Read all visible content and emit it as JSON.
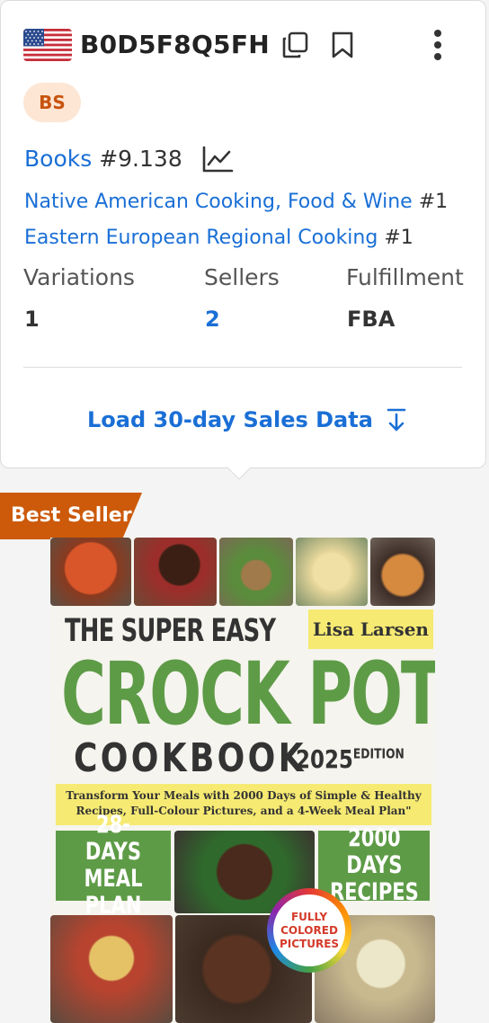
{
  "product": {
    "marketplace_flag": "us-flag-icon",
    "asin": "B0D5F8Q5FH",
    "badge": "BS",
    "category": "Books",
    "category_rank": "#9.138",
    "sub_ranks": [
      {
        "name": "Native American Cooking, Food & Wine",
        "rank": "#1"
      },
      {
        "name": "Eastern European Regional Cooking",
        "rank": "#1"
      }
    ],
    "stats": {
      "variations_label": "Variations",
      "variations_value": "1",
      "sellers_label": "Sellers",
      "sellers_value": "2",
      "fulfillment_label": "Fulfillment",
      "fulfillment_value": "FBA"
    },
    "load_button": "Load 30-day Sales Data"
  },
  "listing": {
    "ribbon": "Best Seller",
    "cover": {
      "line1": "THE SUPER EASY",
      "author": "Lisa Larsen",
      "line2": "CROCK POT",
      "line3": "COOKBOOK",
      "year": "2025",
      "edition": "EDITION",
      "tagline": "Transform Your Meals with 2000 Days of Simple & Healthy Recipes, Full-Colour Pictures, and a 4-Week Meal Plan\"",
      "left_block": "28-DAYS MEAL PLAN",
      "right_block": "2000 DAYS RECIPES",
      "seal": "FULLY COLORED PICTURES"
    }
  },
  "colors": {
    "link": "#1a6fd6",
    "badge_bg": "#fde6d4",
    "badge_text": "#c8540f",
    "ribbon": "#cc5a0a",
    "cover_green": "#5e9b47",
    "cover_yellow": "#f6ea73"
  }
}
